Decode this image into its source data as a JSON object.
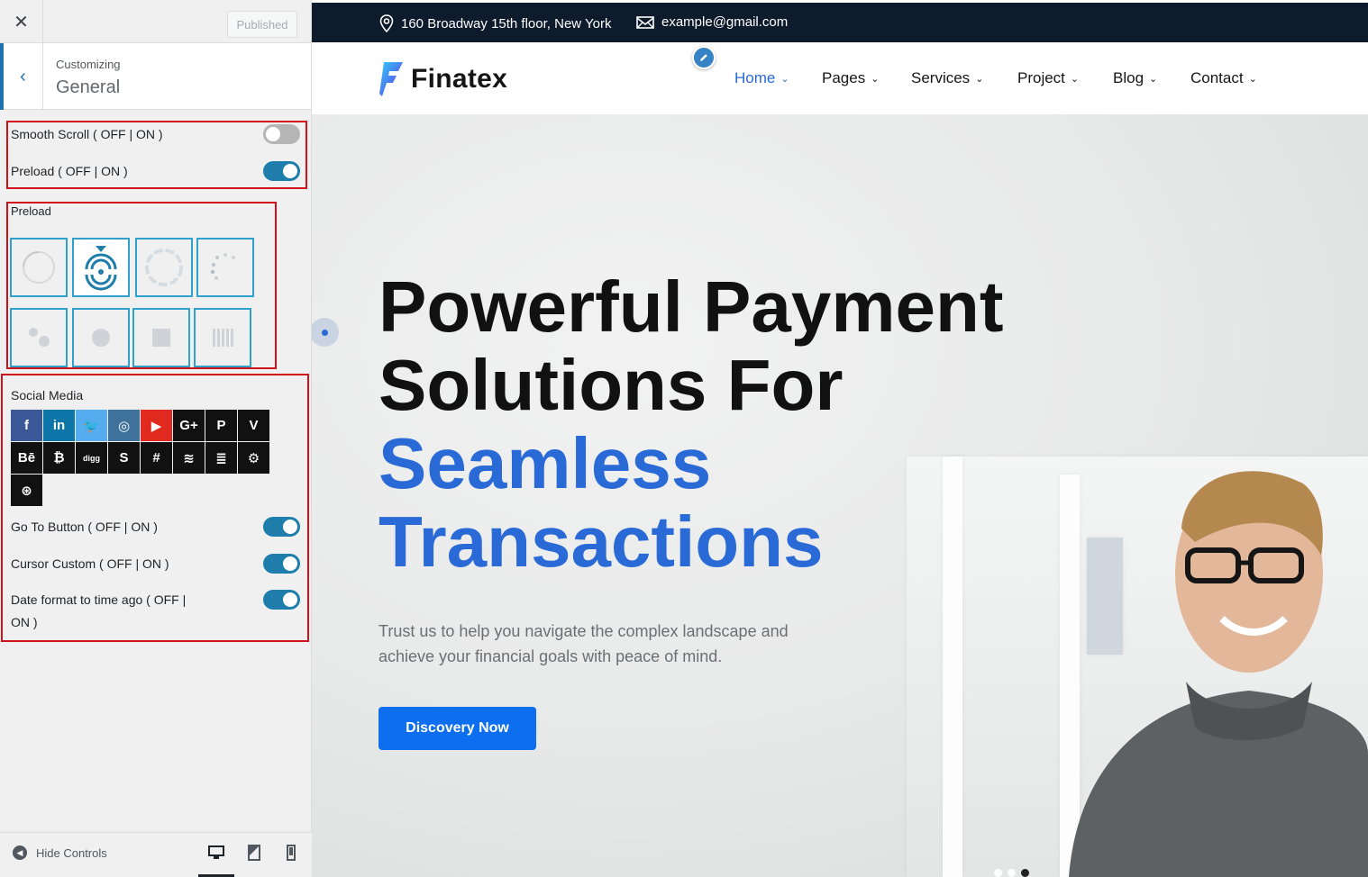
{
  "customizer": {
    "close_icon": "close-icon",
    "published_label": "Published",
    "customizing_label": "Customizing",
    "section_title": "General",
    "options_top": [
      {
        "label": "Smooth Scroll ( OFF | ON )",
        "state": "off"
      },
      {
        "label": "Preload ( OFF | ON )",
        "state": "on"
      }
    ],
    "preload_label": "Preload",
    "preload_styles": [
      "spinner-arc",
      "spinner-rings",
      "spinner-circle-dashed",
      "spinner-dots",
      "bouncing-dots",
      "pulse-dot",
      "square",
      "bars"
    ],
    "preload_selected_index": 1,
    "social_label": "Social Media",
    "social_icons": [
      {
        "name": "facebook",
        "glyph": "f",
        "color": "#3b5998"
      },
      {
        "name": "linkedin",
        "glyph": "in",
        "color": "#0e76a8"
      },
      {
        "name": "twitter",
        "glyph": "🐦",
        "color": "#55acee"
      },
      {
        "name": "instagram",
        "glyph": "◎",
        "color": "#3f729b"
      },
      {
        "name": "youtube",
        "glyph": "▶",
        "color": "#e02a20"
      },
      {
        "name": "google-plus",
        "glyph": "G+",
        "color": "#111111"
      },
      {
        "name": "pinterest",
        "glyph": "P",
        "color": "#111111"
      },
      {
        "name": "vimeo",
        "glyph": "V",
        "color": "#111111"
      },
      {
        "name": "behance",
        "glyph": "Bē",
        "color": "#111111"
      },
      {
        "name": "bitcoin",
        "glyph": "₿",
        "color": "#111111"
      },
      {
        "name": "digg",
        "glyph": "digg",
        "color": "#111111"
      },
      {
        "name": "skype",
        "glyph": "S",
        "color": "#111111"
      },
      {
        "name": "slack",
        "glyph": "#",
        "color": "#111111"
      },
      {
        "name": "spotify",
        "glyph": "≋",
        "color": "#111111"
      },
      {
        "name": "stack-overflow",
        "glyph": "≣",
        "color": "#111111"
      },
      {
        "name": "steam",
        "glyph": "⚙",
        "color": "#111111"
      },
      {
        "name": "dribbble",
        "glyph": "⊛",
        "color": "#111111"
      }
    ],
    "options_bottom": [
      {
        "label": "Go To Button ( OFF | ON )",
        "state": "on"
      },
      {
        "label": "Cursor Custom ( OFF | ON )",
        "state": "on"
      },
      {
        "label": "Date format to time ago ( OFF |",
        "label_line2": "ON )",
        "state": "on"
      }
    ],
    "hide_controls_label": "Hide Controls",
    "devices": [
      "desktop-icon",
      "tablet-icon",
      "mobile-icon"
    ]
  },
  "site": {
    "topbar": {
      "address": "160 Broadway 15th floor, New York",
      "email": "example@gmail.com"
    },
    "logo_text": "Finatex",
    "nav": [
      {
        "label": "Home",
        "active": true
      },
      {
        "label": "Pages",
        "active": false
      },
      {
        "label": "Services",
        "active": false
      },
      {
        "label": "Project",
        "active": false
      },
      {
        "label": "Blog",
        "active": false
      },
      {
        "label": "Contact",
        "active": false
      }
    ],
    "hero": {
      "title_line1": "Powerful Payment",
      "title_line2": "Solutions For",
      "title_line3": "Seamless",
      "title_line4": "Transactions",
      "subtitle": "Trust us to help you navigate the complex landscape and achieve your financial goals with peace of mind.",
      "cta_label": "Discovery Now"
    },
    "colors": {
      "accent": "#2a6ad6",
      "topbar": "#0e1b2d",
      "cta": "#0d6ef0"
    }
  }
}
